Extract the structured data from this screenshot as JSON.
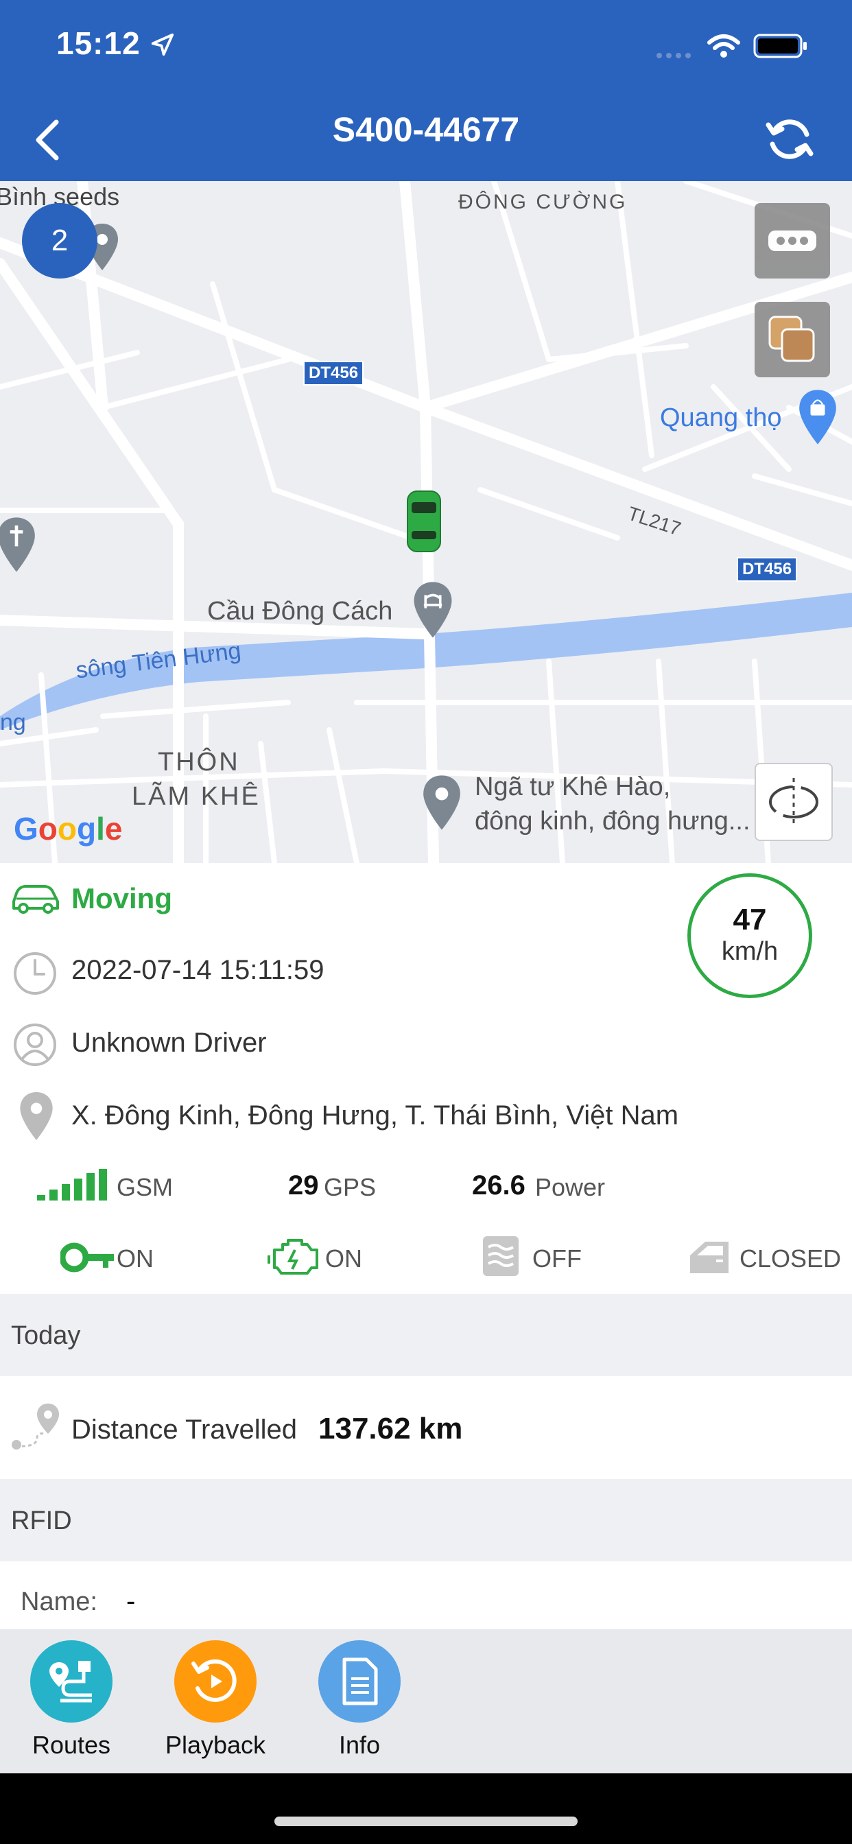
{
  "status_bar": {
    "time": "15:12"
  },
  "nav": {
    "title": "S400-44677"
  },
  "map": {
    "labels": {
      "binh_seeds": "Bình seeds",
      "dong_cuong": "ĐÔNG CƯỜNG",
      "dt456_a": "DT456",
      "dt456_b": "DT456",
      "tl217": "TL217",
      "quang_tho": "Quang thọ",
      "cau_dong_cach": "Cầu Đông Cách",
      "song_tien_hung": "sông Tiên Hưng",
      "ng": "ng",
      "thon_line1": "THÔN",
      "thon_line2": "LÃM KHÊ",
      "nga_tu_line1": "Ngã tư Khê Hào,",
      "nga_tu_line2": "đông kinh, đông hưng...",
      "google": "Google"
    },
    "cluster_count": "2"
  },
  "vehicle": {
    "status": "Moving",
    "timestamp": "2022-07-14 15:11:59",
    "driver": "Unknown Driver",
    "address": "X. Đông Kinh, Đông Hưng, T. Thái Bình, Việt Nam",
    "speed_value": "47",
    "speed_unit": "km/h"
  },
  "signals": {
    "gsm_label": "GSM",
    "gps_value": "29",
    "gps_label": "GPS",
    "power_value": "26.6",
    "power_label": "Power"
  },
  "indicators": {
    "ignition": "ON",
    "engine": "ON",
    "ac": "OFF",
    "door": "CLOSED"
  },
  "today": {
    "section_title": "Today",
    "distance_label": "Distance Travelled",
    "distance_value": "137.62 km"
  },
  "rfid": {
    "section_title": "RFID",
    "name_label": "Name:",
    "name_value": "-"
  },
  "actions": {
    "routes": "Routes",
    "playback": "Playback",
    "info": "Info"
  },
  "colors": {
    "header": "#2a63bd",
    "moving_green": "#2eaa44",
    "routes_fab": "#26b3c9",
    "playback_fab": "#ff9a0d",
    "info_fab": "#5aa3e6"
  }
}
